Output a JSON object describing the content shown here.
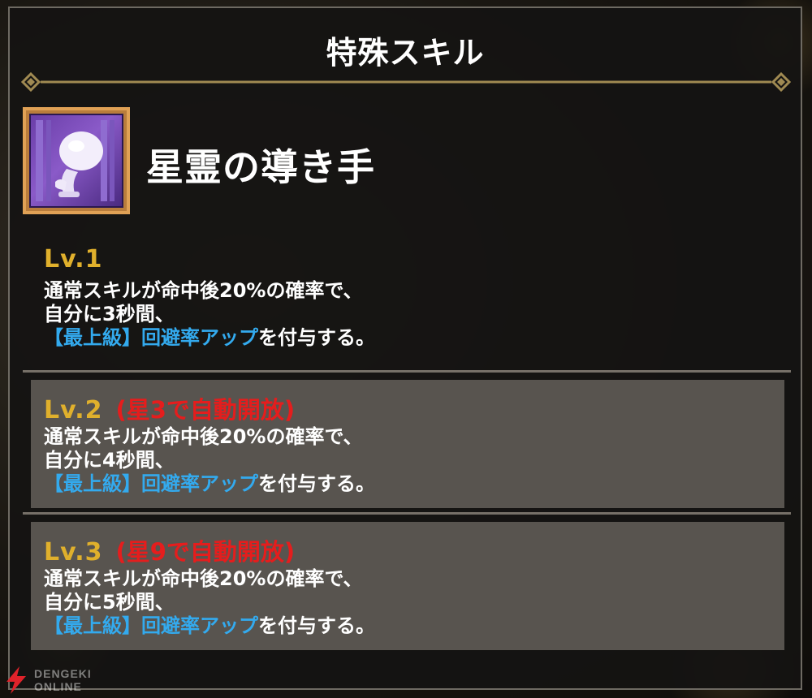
{
  "panel": {
    "title": "特殊スキル"
  },
  "skill": {
    "name": "星霊の導き手",
    "icon": "spirit-figure-icon"
  },
  "levels": [
    {
      "label": "Lv.1",
      "unlock": "",
      "line1": "通常スキルが命中後20%の確率で、",
      "line2": "自分に3秒間、",
      "highlight": "【最上級】回避率アップ",
      "suffix": "を付与する。"
    },
    {
      "label": "Lv.2",
      "unlock": "(星3で自動開放)",
      "line1": "通常スキルが命中後20%の確率で、",
      "line2": "自分に4秒間、",
      "highlight": "【最上級】回避率アップ",
      "suffix": "を付与する。"
    },
    {
      "label": "Lv.3",
      "unlock": "(星9で自動開放)",
      "line1": "通常スキルが命中後20%の確率で、",
      "line2": "自分に5秒間、",
      "highlight": "【最上級】回避率アップ",
      "suffix": "を付与する。"
    }
  ],
  "watermark": {
    "line1": "DENGEKI",
    "line2": "ONLINE"
  },
  "colors": {
    "level_label": "#e0b02c",
    "unlock_text": "#e51d1d",
    "highlight": "#33aaee",
    "locked_bg": "#58544f",
    "icon_frame": "#e0a155"
  }
}
